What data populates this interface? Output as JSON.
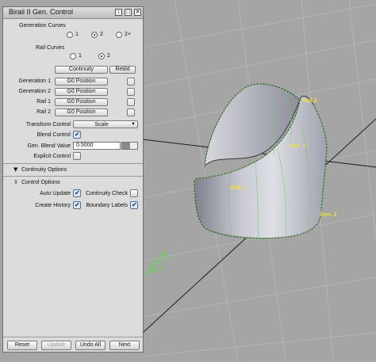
{
  "window": {
    "title": "Birail II Gen. Control",
    "titlebar_buttons": [
      "↕",
      "□",
      "✕"
    ]
  },
  "generation_curves": {
    "label": "Generation Curves",
    "options": [
      "1",
      "2",
      "2+"
    ],
    "selected": "2"
  },
  "rail_curves": {
    "label": "Rail Curves",
    "options": [
      "1",
      "2"
    ],
    "selected": "2"
  },
  "continuity_buttons": {
    "continuity": "Continuity",
    "rebuild": "Rebld"
  },
  "curve_rows": [
    {
      "label": "Generation 1",
      "value": "G0 Position"
    },
    {
      "label": "Generation 2",
      "value": "G0 Position"
    },
    {
      "label": "Rail 1",
      "value": "G0 Position"
    },
    {
      "label": "Rail 2",
      "value": "G0 Position"
    }
  ],
  "transform_control": {
    "label": "Transform Control",
    "value": "Scale"
  },
  "blend_control": {
    "label": "Blend Control",
    "checked": true
  },
  "gen_blend_value": {
    "label": "Gen. Blend Value",
    "value": "0.5000",
    "level": 0.5
  },
  "explicit_control": {
    "label": "Explicit Control",
    "checked": false
  },
  "continuity_options": {
    "label": "Continuity Options"
  },
  "control_options": {
    "label": "Control Options",
    "auto_update": {
      "label": "Auto Update",
      "checked": true
    },
    "continuity_check": {
      "label": "Continuity Check",
      "checked": false
    },
    "create_history": {
      "label": "Create History",
      "checked": true
    },
    "boundary_labels": {
      "label": "Boundary Labels",
      "checked": true
    }
  },
  "bottom_buttons": {
    "reset": "Reset",
    "update": "Update",
    "undo_all": "Undo All",
    "next": "Next"
  },
  "viewport_labels": {
    "rail2": "Rail 2",
    "gen1": "Gen. 1",
    "rail1": "Rail 1",
    "gen2": "Gen. 2"
  },
  "colors": {
    "label_yellow": "#f2e13a",
    "check_blue": "#0d2d6b",
    "surface_gray": "#bfc0c8",
    "axis_green": "#6fcf5a"
  }
}
